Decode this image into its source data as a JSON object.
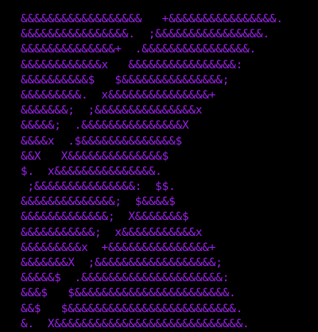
{
  "colors": {
    "background": "#000000",
    "text": "#9b22e8"
  },
  "art_lines": [
    "&&&&&&&&&&&&&&&&&&   +&&&&&&&&&&&&&&&&.",
    "&&&&&&&&&&&&&&&&.  ;&&&&&&&&&&&&&&&&.",
    "&&&&&&&&&&&&&&+  .&&&&&&&&&&&&&&&&.",
    "&&&&&&&&&&&&x   &&&&&&&&&&&&&&&&:",
    "&&&&&&&&&&$   $&&&&&&&&&&&&&&&;",
    "&&&&&&&&&.  x&&&&&&&&&&&&&&&+",
    "&&&&&&&;  ;&&&&&&&&&&&&&&&x",
    "&&&&&;  .&&&&&&&&&&&&&&&X",
    "&&&&x  .$&&&&&&&&&&&&&&$",
    "&&X   X&&&&&&&&&&&&&&$",
    "$.  x&&&&&&&&&&&&&&&.",
    " ;&&&&&&&&&&&&&&&:  $$.",
    "&&&&&&&&&&&&&&;  $&&&&$",
    "&&&&&&&&&&&&&;  X&&&&&&&$",
    "&&&&&&&&&&&;  x&&&&&&&&&&&x",
    "&&&&&&&&&x  +&&&&&&&&&&&&&&&+",
    "&&&&&&&X  ;&&&&&&&&&&&&&&&&&&;",
    "&&&&&$  .&&&&&&&&&&&&&&&&&&&&&:",
    "&&&$   $&&&&&&&&&&&&&&&&&&&&&&&.",
    "&&$   $&&&&&&&&&&&&&&&&&&&&&&&&&.",
    "&.  X&&&&&&&&&&&&&&&&&&&&&&&&&&&&."
  ]
}
